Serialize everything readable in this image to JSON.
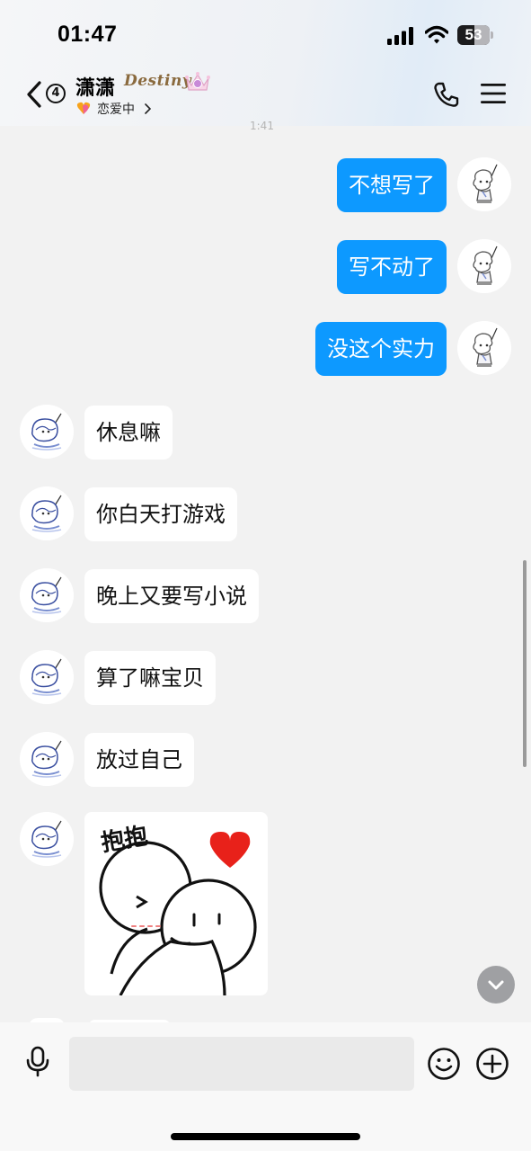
{
  "status_bar": {
    "time": "01:47",
    "battery": "53"
  },
  "header": {
    "unread_count": "4",
    "contact_name": "潇潇",
    "badge_text": "Destiny",
    "status": "恋爱中",
    "partial_timestamp": "1:41"
  },
  "messages": [
    {
      "direction": "out",
      "text": "不想写了"
    },
    {
      "direction": "out",
      "text": "写不动了"
    },
    {
      "direction": "out",
      "text": "没这个实力"
    },
    {
      "direction": "in",
      "text": "休息嘛"
    },
    {
      "direction": "in",
      "text": "你白天打游戏"
    },
    {
      "direction": "in",
      "text": "晚上又要写小说"
    },
    {
      "direction": "in",
      "text": "算了嘛宝贝"
    },
    {
      "direction": "in",
      "text": "放过自己"
    }
  ],
  "sticker": {
    "text": "抱抱"
  },
  "icons": {
    "back": "chevron-left-icon",
    "phone": "phone-icon",
    "menu": "menu-icon",
    "mic": "microphone-icon",
    "emoji": "smiley-icon",
    "plus": "plus-circle-icon",
    "scroll_down": "chevron-down-icon"
  },
  "colors": {
    "outgoing_bubble": "#0d99ff",
    "incoming_bubble": "#ffffff",
    "background": "#f2f2f2",
    "heart": "#e8211a"
  },
  "input": {
    "value": "",
    "placeholder": ""
  }
}
